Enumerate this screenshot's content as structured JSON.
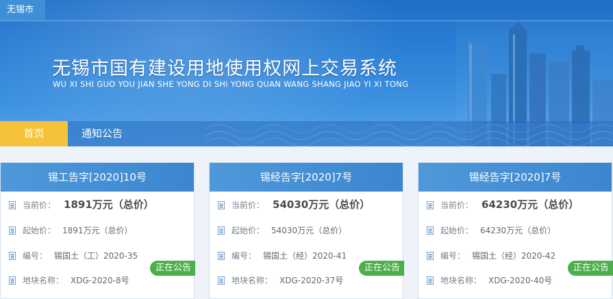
{
  "header": {
    "city_tag": "无锡市",
    "title_cn": "无锡市国有建设用地使用权网上交易系统",
    "title_en": "WU XI SHI GUO YOU JIAN SHE YONG DI SHI YONG QUAN WANG SHANG JIAO YI XI TONG"
  },
  "nav": {
    "home": "首页",
    "notice": "通知公告"
  },
  "labels": {
    "current_price": "当前价：",
    "start_price": "起始价：",
    "number": "编号：",
    "plot_name": "地块名称："
  },
  "cards": [
    {
      "title": "锡工告字[2020]10号",
      "current_price": "1891万元（总价）",
      "start_price": "1891万元（总价）",
      "number": "锡国土（工）2020-35",
      "plot_name": "XDG-2020-8号",
      "status": "正在公告"
    },
    {
      "title": "锡经告字[2020]7号",
      "current_price": "54030万元（总价）",
      "start_price": "54030万元（总价）",
      "number": "锡国土（经）2020-41",
      "plot_name": "XDG-2020-37号",
      "status": "正在公告"
    },
    {
      "title": "锡经告字[2020]7号",
      "current_price": "64230万元（总价）",
      "start_price": "64230万元（总价）",
      "number": "锡国土（经）2020-42",
      "plot_name": "XDG-2020-40号",
      "status": "正在公告"
    }
  ],
  "colors": {
    "banner_blue": "#2b7fd6",
    "nav_active": "#f5c23a",
    "card_header": "#4f98da",
    "status_green": "#4cae4c"
  }
}
